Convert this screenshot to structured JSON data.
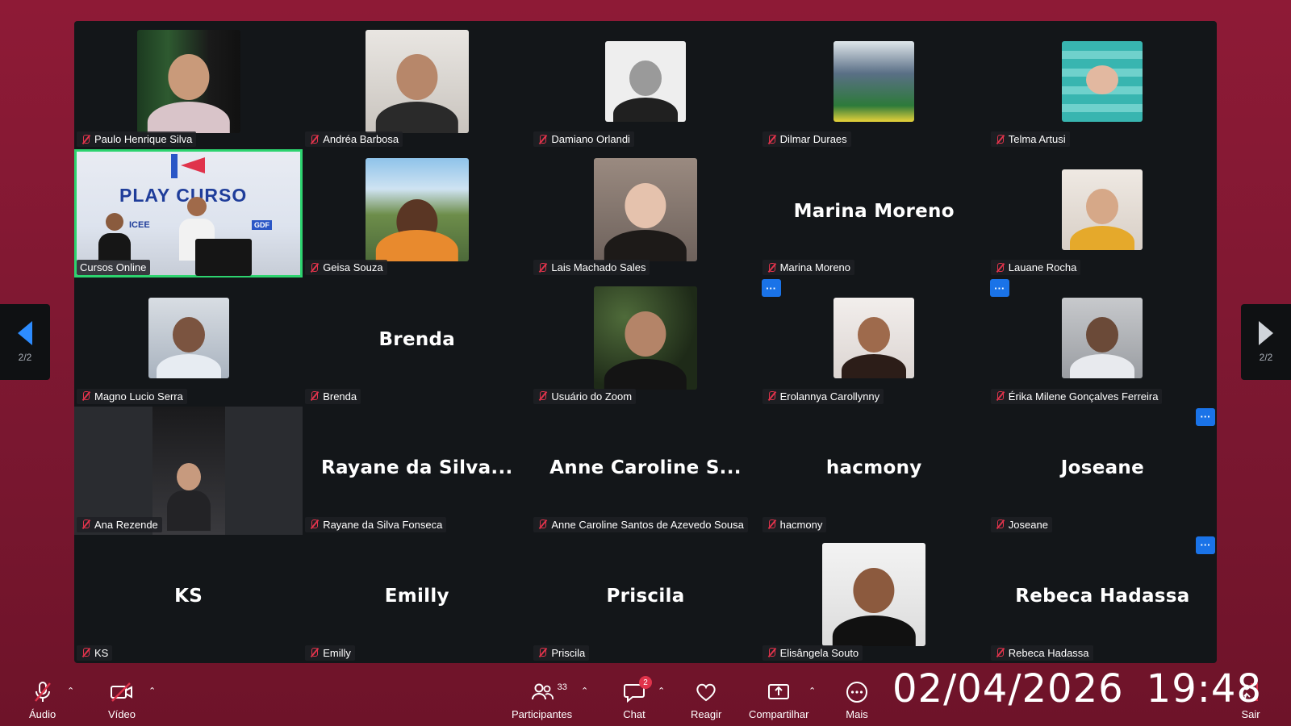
{
  "gallery": {
    "tiles": [
      {
        "name": "Paulo Henrique Silva",
        "type": "video"
      },
      {
        "name": "Andréa Barbosa",
        "type": "video"
      },
      {
        "name": "Damiano Orlandi",
        "type": "video"
      },
      {
        "name": "Dilmar Duraes",
        "type": "video"
      },
      {
        "name": "Telma Artusi",
        "type": "video"
      },
      {
        "name": "Cursos Online",
        "type": "video",
        "banner_text": "PLAY CURSO",
        "banner_small": "ICEE",
        "banner_tag": "GDF"
      },
      {
        "name": "Geisa Souza",
        "type": "video"
      },
      {
        "name": "Lais Machado Sales",
        "type": "video"
      },
      {
        "name": "Marina Moreno",
        "type": "name",
        "display": "Marina Moreno"
      },
      {
        "name": "Lauane Rocha",
        "type": "video"
      },
      {
        "name": "Magno Lucio Serra",
        "type": "video"
      },
      {
        "name": "Brenda",
        "type": "name",
        "display": "Brenda"
      },
      {
        "name": "Usuário do Zoom",
        "type": "video"
      },
      {
        "name": "Erolannya Carollynny",
        "type": "video"
      },
      {
        "name": "Érika Milene Gonçalves Ferreira",
        "type": "video"
      },
      {
        "name": "Ana Rezende",
        "type": "video"
      },
      {
        "name": "Rayane da Silva Fonseca",
        "type": "name",
        "display": "Rayane da Silva..."
      },
      {
        "name": "Anne Caroline Santos de Azevedo Sousa",
        "type": "name",
        "display": "Anne Caroline S..."
      },
      {
        "name": "hacmony",
        "type": "name",
        "display": "hacmony"
      },
      {
        "name": "Joseane",
        "type": "name",
        "display": "Joseane"
      },
      {
        "name": "KS",
        "type": "name",
        "display": "KS"
      },
      {
        "name": "Emilly",
        "type": "name",
        "display": "Emilly"
      },
      {
        "name": "Priscila",
        "type": "name",
        "display": "Priscila"
      },
      {
        "name": "Elisângela Souto",
        "type": "video"
      },
      {
        "name": "Rebeca Hadassa",
        "type": "name",
        "display": "Rebeca Hadassa"
      }
    ],
    "more_button": "···"
  },
  "pager": {
    "left_label": "2/2",
    "right_label": "2/2"
  },
  "toolbar": {
    "audio_label": "Áudio",
    "video_label": "Vídeo",
    "participants_label": "Participantes",
    "participants_count": "33",
    "chat_label": "Chat",
    "chat_badge": "2",
    "react_label": "Reagir",
    "share_label": "Compartilhar",
    "more_label": "Mais",
    "leave_label": "Sair"
  },
  "datetime": {
    "date": "02/04/2026",
    "time": "19:48"
  },
  "colors": {
    "accent": "#2d8cff",
    "active_border": "#2dd36f",
    "muted_red": "#e0334b",
    "background": "#8e1a36"
  }
}
